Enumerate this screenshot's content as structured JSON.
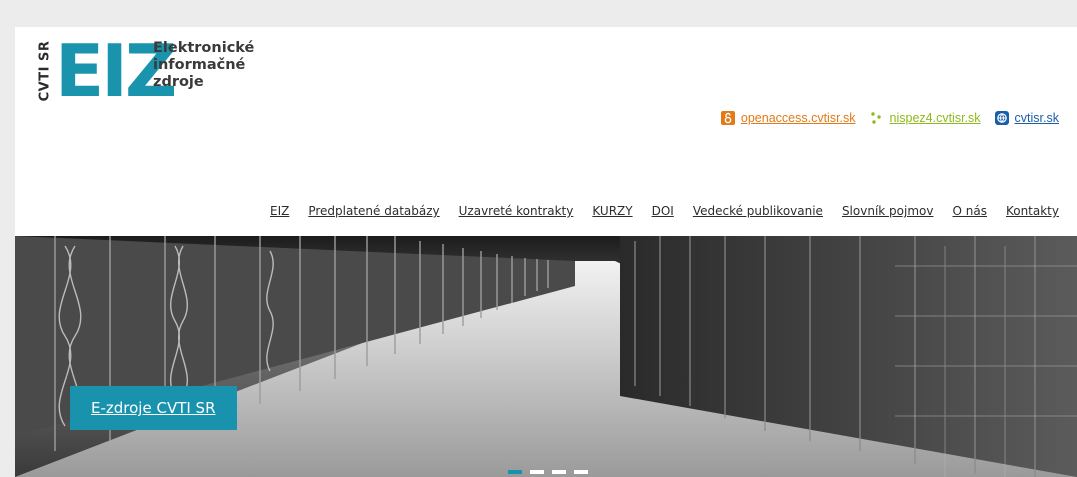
{
  "logo": {
    "vertical": "CVTI SR",
    "letters": "EIZ",
    "line1": "Elektronické",
    "line2": "informačné",
    "line3": "zdroje"
  },
  "toplinks": [
    {
      "label": "openaccess.cvtisr.sk",
      "icon": "open-access-icon",
      "color": "#e07b18"
    },
    {
      "label": "nispez4.cvtisr.sk",
      "icon": "nispez-dots-icon",
      "color": "#8dbb1c"
    },
    {
      "label": "cvtisr.sk",
      "icon": "cvti-globe-icon",
      "color": "#1b5ea8"
    }
  ],
  "nav": [
    "EIZ",
    "Predplatené databázy",
    "Uzavreté kontrakty",
    "KURZY",
    "DOI",
    "Vedecké publikovanie",
    "Slovník pojmov",
    "O nás",
    "Kontakty"
  ],
  "banner": {
    "button_label": "E-zdroje CVTI SR",
    "accent": "#1993ad",
    "slides": 4,
    "active_slide": 1
  }
}
